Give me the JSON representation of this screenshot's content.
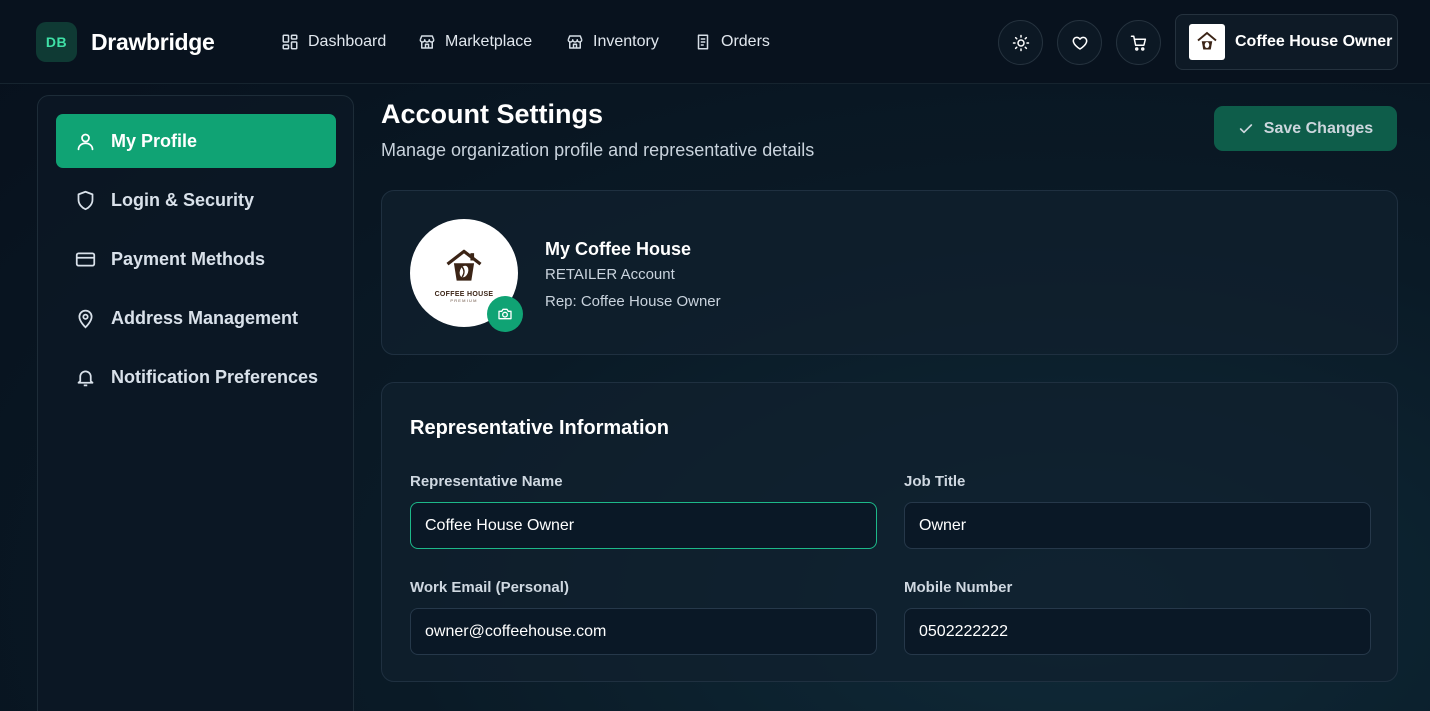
{
  "app": {
    "logo_initials": "DB",
    "brand_name": "Drawbridge"
  },
  "nav": {
    "items": [
      {
        "label": "Dashboard",
        "icon": "grid-icon"
      },
      {
        "label": "Marketplace",
        "icon": "store-icon"
      },
      {
        "label": "Inventory",
        "icon": "store-icon"
      },
      {
        "label": "Orders",
        "icon": "document-icon"
      }
    ],
    "actions": [
      "sun-icon",
      "heart-icon",
      "cart-icon"
    ],
    "account_name": "Coffee House Owner"
  },
  "sidebar": {
    "items": [
      {
        "label": "My Profile",
        "icon": "user-icon",
        "active": true
      },
      {
        "label": "Login & Security",
        "icon": "shield-icon",
        "active": false
      },
      {
        "label": "Payment Methods",
        "icon": "credit-card-icon",
        "active": false
      },
      {
        "label": "Address Management",
        "icon": "map-pin-icon",
        "active": false
      },
      {
        "label": "Notification Preferences",
        "icon": "bell-icon",
        "active": false
      }
    ]
  },
  "page": {
    "title": "Account Settings",
    "subtitle": "Manage organization profile and representative details",
    "save_label": "Save Changes"
  },
  "profile": {
    "logo_text": "COFFEE HOUSE",
    "logo_sub": "PREMIUM",
    "org_name": "My Coffee House",
    "account_type": "RETAILER Account",
    "rep_line": "Rep: Coffee House Owner"
  },
  "representative": {
    "section_title": "Representative Information",
    "fields": {
      "name": {
        "label": "Representative Name",
        "value": "Coffee House Owner"
      },
      "job_title": {
        "label": "Job Title",
        "value": "Owner"
      },
      "email": {
        "label": "Work Email (Personal)",
        "value": "owner@coffeehouse.com"
      },
      "mobile": {
        "label": "Mobile Number",
        "value": "0502222222"
      }
    }
  },
  "colors": {
    "accent": "#10a374",
    "logo_badge_text": "#3fe0a6",
    "save_button": "#0e5d4a",
    "focus_border": "#1db889"
  }
}
